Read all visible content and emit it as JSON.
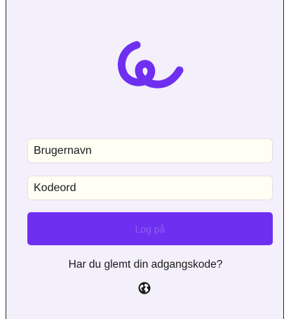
{
  "brand": {
    "logo_icon": "swirl-logo-icon",
    "accent_color": "#6f2ff0"
  },
  "form": {
    "username_placeholder": "Brugernavn",
    "password_placeholder": "Kodeord",
    "login_label": "Log på",
    "login_enabled": false
  },
  "links": {
    "forgot_password": "Har du glemt din adgangskode?"
  },
  "footer": {
    "language_icon": "globe-icon"
  }
}
